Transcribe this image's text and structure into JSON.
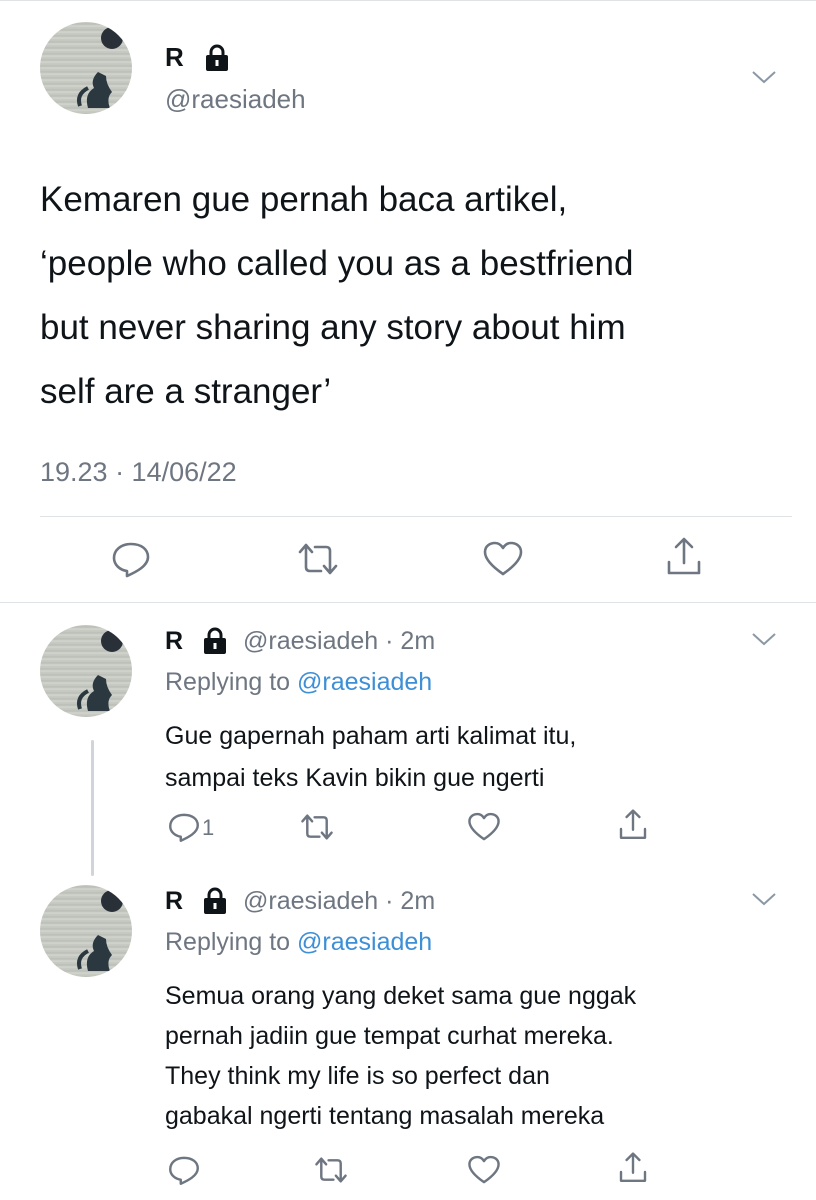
{
  "main_tweet": {
    "display_name": "R",
    "handle": "@raesiadeh",
    "text_lines": [
      "Kemaren gue pernah baca artikel,",
      "‘people who called you as a bestfriend",
      "but never sharing any story about him",
      "self are a stranger’"
    ],
    "timestamp": "19.23 · 14/06/22"
  },
  "replies": [
    {
      "display_name": "R",
      "handle": "@raesiadeh",
      "time": "· 2m",
      "replying_prefix": "Replying to",
      "replying_to": "@raesiadeh",
      "text_lines": [
        "Gue gapernah paham arti kalimat itu,",
        "sampai teks Kavin bikin gue ngerti"
      ],
      "reply_count": "1"
    },
    {
      "display_name": "R",
      "handle": "@raesiadeh",
      "time": "· 2m",
      "replying_prefix": "Replying to",
      "replying_to": "@raesiadeh",
      "text_lines": [
        "Semua orang yang deket sama gue nggak",
        "pernah jadiin gue tempat curhat mereka.",
        "They think my life is so perfect dan",
        "gabakal ngerti tentang masalah mereka"
      ],
      "reply_count": ""
    }
  ],
  "icons": {
    "lock": "lock-icon",
    "chevron": "chevron-down-icon",
    "reply": "reply-icon",
    "retweet": "retweet-icon",
    "like": "heart-icon",
    "share": "share-icon"
  },
  "colors": {
    "text": "#0f1419",
    "muted": "#6e7681",
    "link": "#3d8fd6",
    "divider": "#dfe3e6"
  }
}
